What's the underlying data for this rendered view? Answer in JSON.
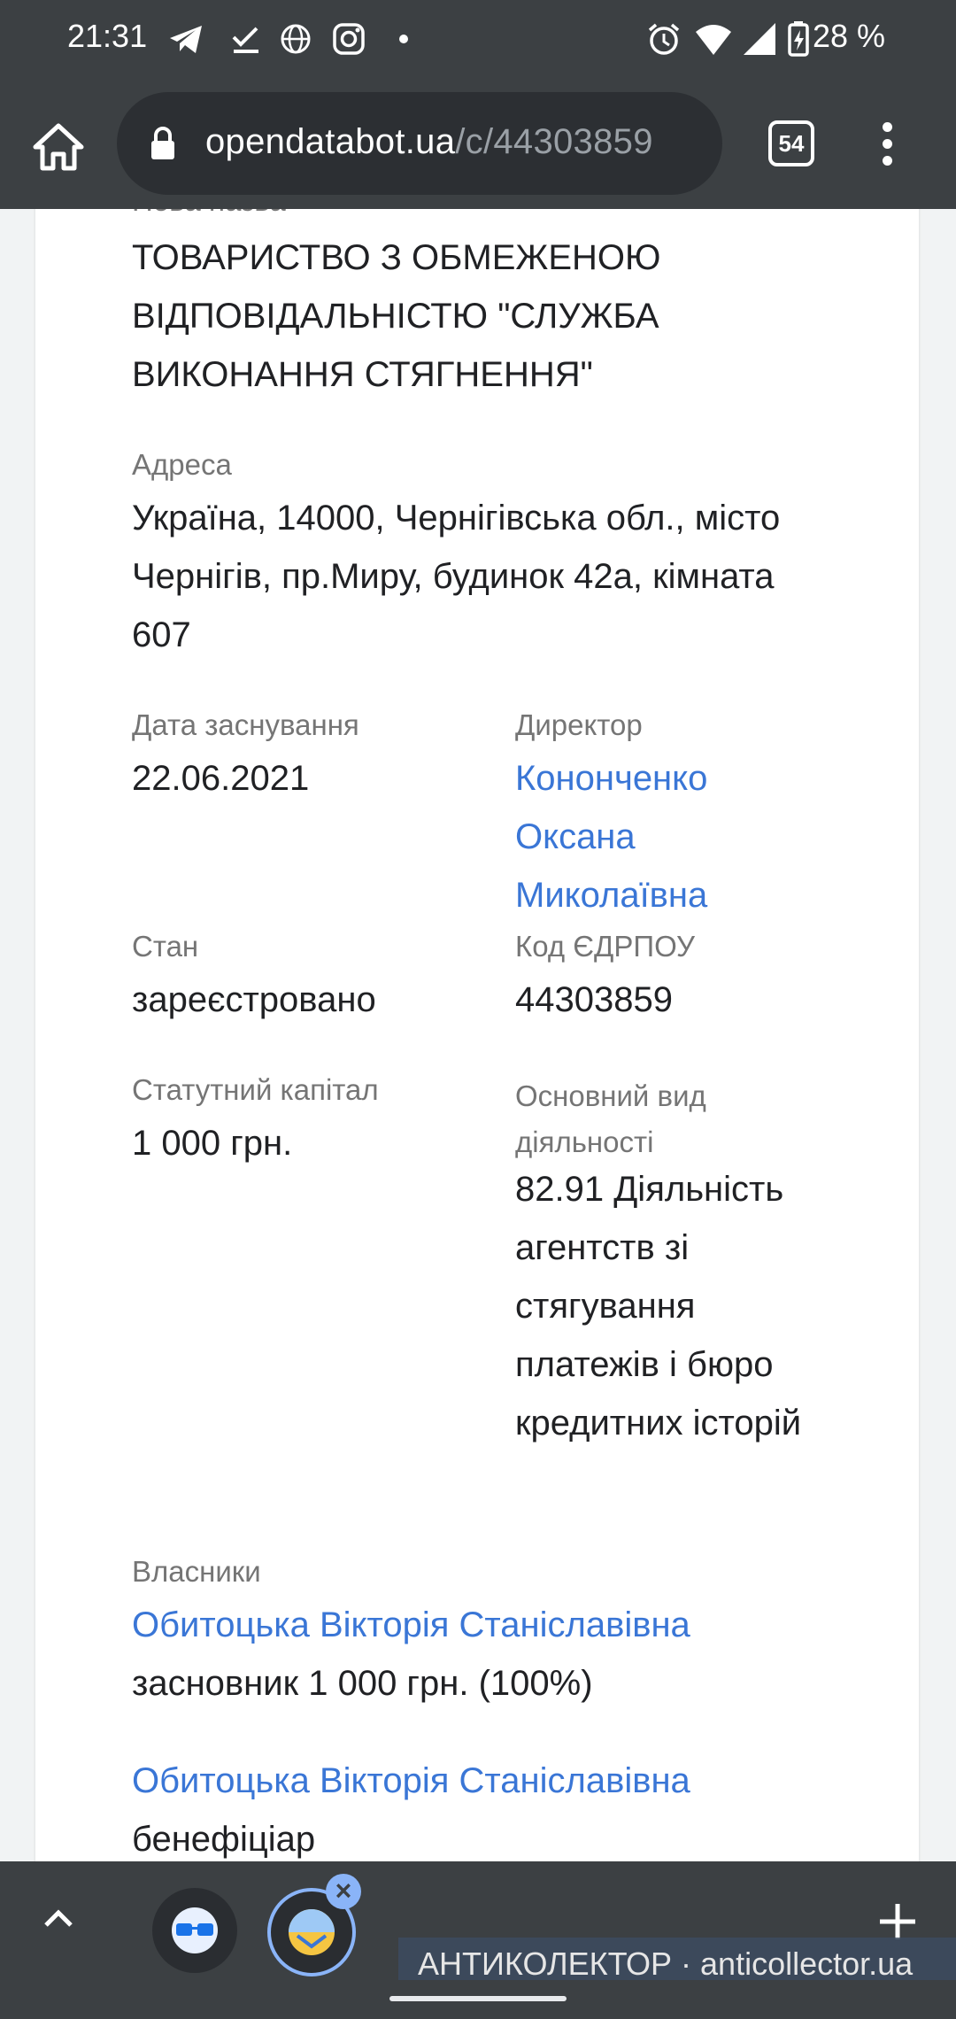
{
  "status_bar": {
    "time": "21:31",
    "left_icons": [
      "telegram-icon",
      "check-icon",
      "globe-icon",
      "instagram-icon",
      "dot-icon"
    ],
    "right_icons": [
      "alarm-icon",
      "wifi-icon",
      "signal-icon",
      "battery-charging-icon"
    ],
    "battery": "28 %"
  },
  "browser": {
    "url_host": "opendatabot.ua",
    "url_path": "/c/44303859",
    "tab_count": "54"
  },
  "company": {
    "name_label_partial": "Нова назва",
    "name": "ТОВАРИСТВО З ОБМЕЖЕНОЮ ВІДПОВІДАЛЬНІСТЮ \"СЛУЖБА ВИКОНАННЯ СТЯГНЕННЯ\"",
    "address_label": "Адреса",
    "address": "Україна, 14000, Чернігівська обл., місто Чернігів, пр.Миру, будинок 42а, кімната 607",
    "founded_label": "Дата заснування",
    "founded": "22.06.2021",
    "director_label": "Директор",
    "director": "Кононченко Оксана Миколаївна",
    "status_label": "Стан",
    "status": "зареєстровано",
    "code_label": "Код ЄДРПОУ",
    "code": "44303859",
    "capital_label": "Статутний капітал",
    "capital": "1 000 грн.",
    "activity_label": "Основний вид діяльності",
    "activity": "82.91 Діяльність агентств зі стягування платежів і бюро кредитних історій",
    "owners_label": "Власники",
    "owners": [
      {
        "name": "Обитоцька Вікторія Станіславівна",
        "role": "засновник 1 000 грн. (100%)"
      },
      {
        "name": "Обитоцька Вікторія Станіславівна",
        "role": "бенефіціар"
      }
    ]
  },
  "watermark": "АНТИКОЛЕКТОР · anticollector.ua"
}
